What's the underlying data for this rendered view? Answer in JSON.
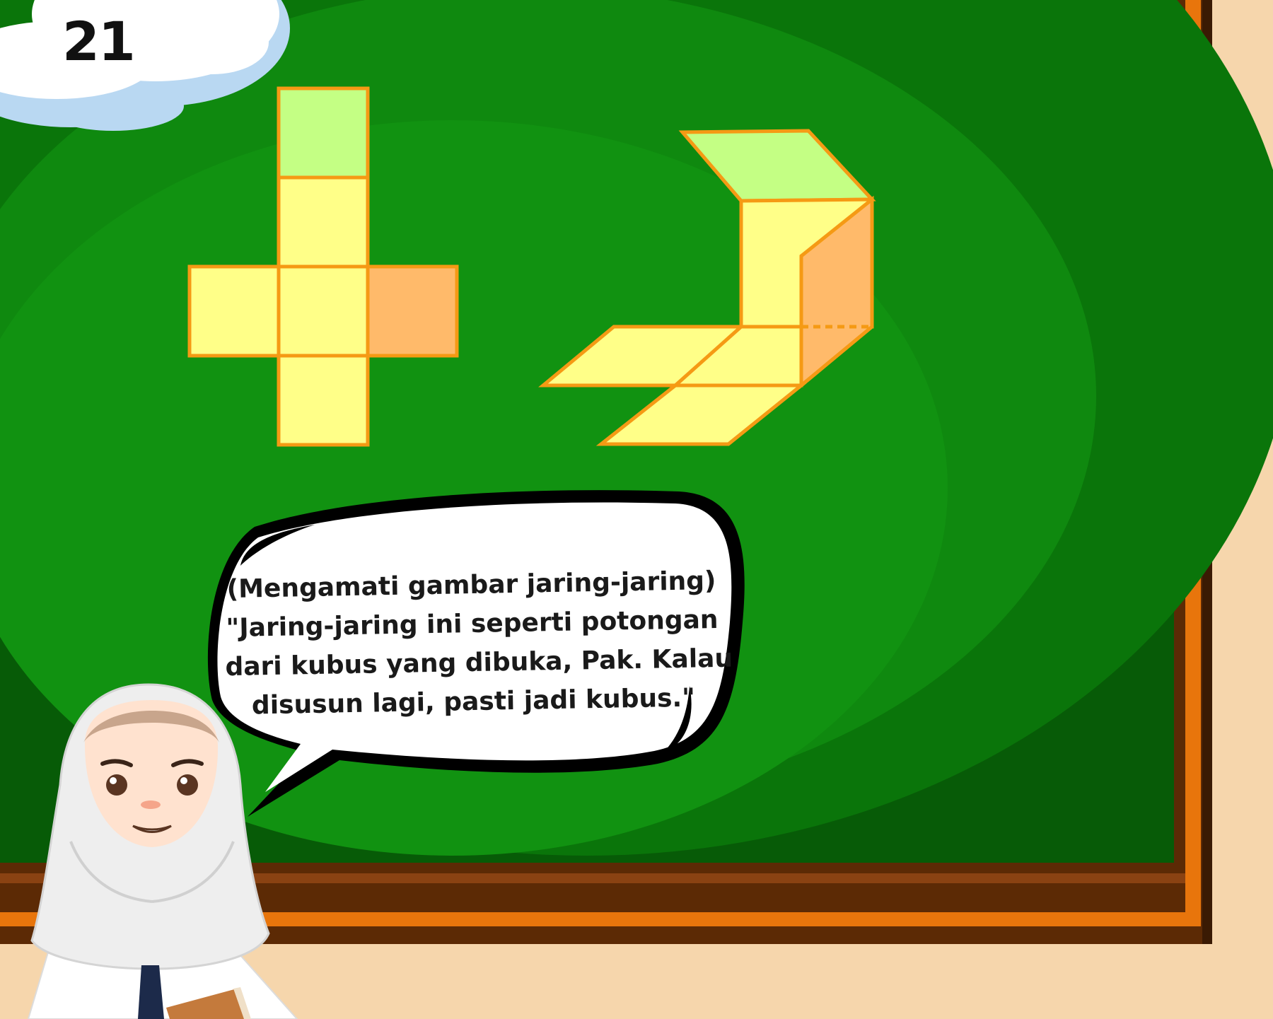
{
  "page": {
    "number": "21"
  },
  "speech_bubble": {
    "lines": [
      "(Mengamati gambar jaring-jaring)",
      "\"Jaring-jaring ini seperti potongan",
      "dari kubus yang dibuka, Pak. Kalau",
      "disusun lagi, pasti jadi kubus.\""
    ]
  },
  "colors": {
    "board_dark": "#075b07",
    "board_light": "#139613",
    "frame_wood": "#5c2a05",
    "frame_orange": "#e8750c",
    "face_yellow": "#ffff88",
    "face_green": "#c4ff84",
    "face_orange": "#ffba6a",
    "face_outline": "#f59a14",
    "wall": "#f6d6ac"
  },
  "icons": [
    "cloud-icon",
    "cube-net-cross-icon",
    "cube-net-folding-icon",
    "student-character-icon"
  ]
}
